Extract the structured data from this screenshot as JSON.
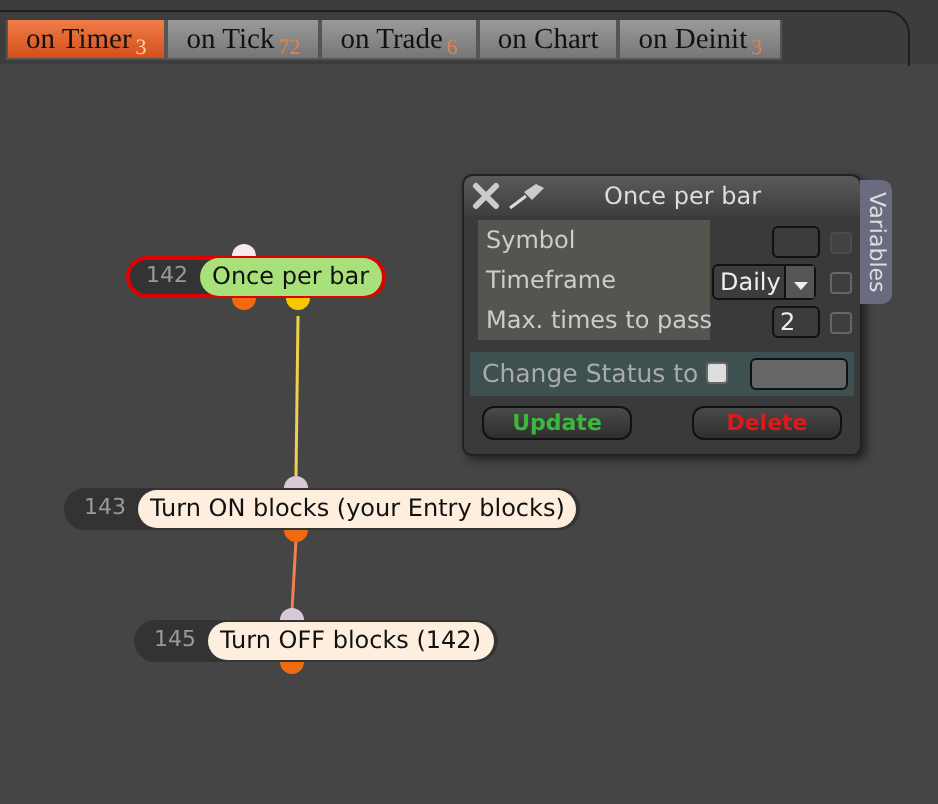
{
  "tabs": [
    {
      "label": "on Timer",
      "count": "3",
      "selected": true
    },
    {
      "label": "on Tick",
      "count": "72",
      "selected": false
    },
    {
      "label": "on Trade",
      "count": "6",
      "selected": false
    },
    {
      "label": "on Chart",
      "selected": false
    },
    {
      "label": "on Deinit",
      "count": "3",
      "selected": false
    }
  ],
  "nodes": [
    {
      "number": "142",
      "label": "Once per bar",
      "selected": true,
      "color": "#a8e07a"
    },
    {
      "number": "143",
      "label": "Turn ON blocks (your Entry blocks)",
      "selected": false,
      "color": "#fdeedd"
    },
    {
      "number": "145",
      "label": "Turn OFF blocks (142)",
      "selected": false,
      "color": "#fdeedd"
    }
  ],
  "panel": {
    "title": "Once per bar",
    "side_tab": "Variables",
    "fields": [
      {
        "label": "Symbol",
        "kind": "text",
        "disabled": true,
        "checked": false
      },
      {
        "label": "Timeframe",
        "kind": "select",
        "value": "Daily",
        "disabled": false,
        "checked": false
      },
      {
        "label": "Max. times to pass",
        "kind": "text",
        "value": "2",
        "disabled": false,
        "checked": false
      }
    ],
    "status": {
      "label": "Change Status to",
      "checked": false
    },
    "buttons": [
      {
        "label": "Update",
        "kind": "update"
      },
      {
        "label": "Delete",
        "kind": "delete"
      }
    ]
  }
}
